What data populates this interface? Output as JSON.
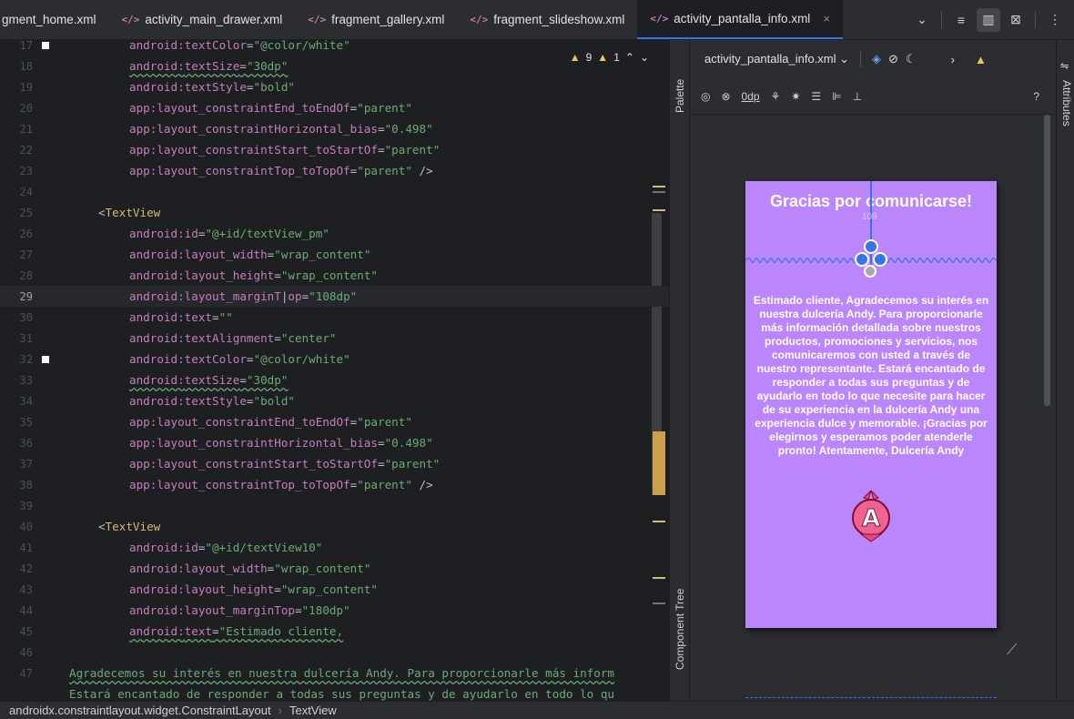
{
  "tabs": [
    {
      "label": "gment_home.xml",
      "active": false,
      "icon": false
    },
    {
      "label": "activity_main_drawer.xml",
      "active": false,
      "icon": true
    },
    {
      "label": "fragment_gallery.xml",
      "active": false,
      "icon": true
    },
    {
      "label": "fragment_slideshow.xml",
      "active": false,
      "icon": true
    },
    {
      "label": "activity_pantalla_info.xml",
      "active": true,
      "icon": true
    }
  ],
  "tab_icon_text": "</>",
  "tab_close": "×",
  "tab_tools": {
    "chevron": "⌄",
    "code_view": "≡",
    "split_view": "▥",
    "design_view": "⊠",
    "more": "⋮"
  },
  "warnings": {
    "warn_count": "9",
    "weak_count": "1",
    "warn_icon": "▲"
  },
  "lines": [
    {
      "n": "17",
      "mark": true,
      "indent": 2,
      "parts": [
        [
          "ns",
          "android:"
        ],
        [
          "attr",
          "textColor"
        ],
        [
          "punct",
          "="
        ],
        [
          "val",
          "\"@color/white\""
        ]
      ]
    },
    {
      "n": "18",
      "mark": false,
      "indent": 2,
      "wavy": true,
      "parts": [
        [
          "ns",
          "android:"
        ],
        [
          "attr",
          "textSize"
        ],
        [
          "punct",
          "="
        ],
        [
          "val",
          "\"30dp\""
        ]
      ]
    },
    {
      "n": "19",
      "mark": false,
      "indent": 2,
      "parts": [
        [
          "ns",
          "android:"
        ],
        [
          "attr",
          "textStyle"
        ],
        [
          "punct",
          "="
        ],
        [
          "val",
          "\"bold\""
        ]
      ]
    },
    {
      "n": "20",
      "mark": false,
      "indent": 2,
      "parts": [
        [
          "ns",
          "app:"
        ],
        [
          "attr",
          "layout_constraintEnd_toEndOf"
        ],
        [
          "punct",
          "="
        ],
        [
          "val",
          "\"parent\""
        ]
      ]
    },
    {
      "n": "21",
      "mark": false,
      "indent": 2,
      "parts": [
        [
          "ns",
          "app:"
        ],
        [
          "attr",
          "layout_constraintHorizontal_bias"
        ],
        [
          "punct",
          "="
        ],
        [
          "val",
          "\"0.498\""
        ]
      ]
    },
    {
      "n": "22",
      "mark": false,
      "indent": 2,
      "parts": [
        [
          "ns",
          "app:"
        ],
        [
          "attr",
          "layout_constraintStart_toStartOf"
        ],
        [
          "punct",
          "="
        ],
        [
          "val",
          "\"parent\""
        ]
      ]
    },
    {
      "n": "23",
      "mark": false,
      "indent": 2,
      "parts": [
        [
          "ns",
          "app:"
        ],
        [
          "attr",
          "layout_constraintTop_toTopOf"
        ],
        [
          "punct",
          "="
        ],
        [
          "val",
          "\"parent\""
        ],
        [
          "punct",
          " />"
        ]
      ]
    },
    {
      "n": "24",
      "mark": false,
      "indent": 0,
      "parts": []
    },
    {
      "n": "25",
      "mark": false,
      "indent": 1,
      "parts": [
        [
          "punct",
          "<"
        ],
        [
          "tag",
          "TextView"
        ]
      ]
    },
    {
      "n": "26",
      "mark": false,
      "indent": 2,
      "parts": [
        [
          "ns",
          "android:"
        ],
        [
          "attr",
          "id"
        ],
        [
          "punct",
          "="
        ],
        [
          "val",
          "\"@+id/textView_pm\""
        ]
      ]
    },
    {
      "n": "27",
      "mark": false,
      "indent": 2,
      "parts": [
        [
          "ns",
          "android:"
        ],
        [
          "attr",
          "layout_width"
        ],
        [
          "punct",
          "="
        ],
        [
          "val",
          "\"wrap_content\""
        ]
      ]
    },
    {
      "n": "28",
      "mark": false,
      "indent": 2,
      "parts": [
        [
          "ns",
          "android:"
        ],
        [
          "attr",
          "layout_height"
        ],
        [
          "punct",
          "="
        ],
        [
          "val",
          "\"wrap_content\""
        ]
      ]
    },
    {
      "n": "29",
      "mark": false,
      "indent": 2,
      "current": true,
      "parts": [
        [
          "ns",
          "android:"
        ],
        [
          "attr",
          "layout_marginT"
        ],
        [
          "punct",
          "|"
        ],
        [
          "attr",
          "op"
        ],
        [
          "punct",
          "="
        ],
        [
          "val",
          "\"108dp\""
        ]
      ]
    },
    {
      "n": "30",
      "mark": false,
      "indent": 2,
      "parts": [
        [
          "ns",
          "android:"
        ],
        [
          "attr",
          "text"
        ],
        [
          "punct",
          "="
        ],
        [
          "val",
          "\"\""
        ]
      ]
    },
    {
      "n": "31",
      "mark": false,
      "indent": 2,
      "parts": [
        [
          "ns",
          "android:"
        ],
        [
          "attr",
          "textAlignment"
        ],
        [
          "punct",
          "="
        ],
        [
          "val",
          "\"center\""
        ]
      ]
    },
    {
      "n": "32",
      "mark": true,
      "indent": 2,
      "parts": [
        [
          "ns",
          "android:"
        ],
        [
          "attr",
          "textColor"
        ],
        [
          "punct",
          "="
        ],
        [
          "val",
          "\"@color/white\""
        ]
      ]
    },
    {
      "n": "33",
      "mark": false,
      "indent": 2,
      "wavy": true,
      "parts": [
        [
          "ns",
          "android:"
        ],
        [
          "attr",
          "textSize"
        ],
        [
          "punct",
          "="
        ],
        [
          "val",
          "\"30dp\""
        ]
      ]
    },
    {
      "n": "34",
      "mark": false,
      "indent": 2,
      "parts": [
        [
          "ns",
          "android:"
        ],
        [
          "attr",
          "textStyle"
        ],
        [
          "punct",
          "="
        ],
        [
          "val",
          "\"bold\""
        ]
      ]
    },
    {
      "n": "35",
      "mark": false,
      "indent": 2,
      "parts": [
        [
          "ns",
          "app:"
        ],
        [
          "attr",
          "layout_constraintEnd_toEndOf"
        ],
        [
          "punct",
          "="
        ],
        [
          "val",
          "\"parent\""
        ]
      ]
    },
    {
      "n": "36",
      "mark": false,
      "indent": 2,
      "parts": [
        [
          "ns",
          "app:"
        ],
        [
          "attr",
          "layout_constraintHorizontal_bias"
        ],
        [
          "punct",
          "="
        ],
        [
          "val",
          "\"0.498\""
        ]
      ]
    },
    {
      "n": "37",
      "mark": false,
      "indent": 2,
      "parts": [
        [
          "ns",
          "app:"
        ],
        [
          "attr",
          "layout_constraintStart_toStartOf"
        ],
        [
          "punct",
          "="
        ],
        [
          "val",
          "\"parent\""
        ]
      ]
    },
    {
      "n": "38",
      "mark": false,
      "indent": 2,
      "parts": [
        [
          "ns",
          "app:"
        ],
        [
          "attr",
          "layout_constraintTop_toTopOf"
        ],
        [
          "punct",
          "="
        ],
        [
          "val",
          "\"parent\""
        ],
        [
          "punct",
          " />"
        ]
      ]
    },
    {
      "n": "39",
      "mark": false,
      "indent": 0,
      "parts": []
    },
    {
      "n": "40",
      "mark": false,
      "indent": 1,
      "parts": [
        [
          "punct",
          "<"
        ],
        [
          "tag",
          "TextView"
        ]
      ]
    },
    {
      "n": "41",
      "mark": false,
      "indent": 2,
      "parts": [
        [
          "ns",
          "android:"
        ],
        [
          "attr",
          "id"
        ],
        [
          "punct",
          "="
        ],
        [
          "val",
          "\"@+id/textView10\""
        ]
      ]
    },
    {
      "n": "42",
      "mark": false,
      "indent": 2,
      "parts": [
        [
          "ns",
          "android:"
        ],
        [
          "attr",
          "layout_width"
        ],
        [
          "punct",
          "="
        ],
        [
          "val",
          "\"wrap_content\""
        ]
      ]
    },
    {
      "n": "43",
      "mark": false,
      "indent": 2,
      "parts": [
        [
          "ns",
          "android:"
        ],
        [
          "attr",
          "layout_height"
        ],
        [
          "punct",
          "="
        ],
        [
          "val",
          "\"wrap_content\""
        ]
      ]
    },
    {
      "n": "44",
      "mark": false,
      "indent": 2,
      "parts": [
        [
          "ns",
          "android:"
        ],
        [
          "attr",
          "layout_marginTop"
        ],
        [
          "punct",
          "="
        ],
        [
          "val",
          "\"180dp\""
        ]
      ]
    },
    {
      "n": "45",
      "mark": false,
      "indent": 2,
      "wavy": true,
      "parts": [
        [
          "ns",
          "android:"
        ],
        [
          "attr",
          "text"
        ],
        [
          "punct",
          "="
        ],
        [
          "val",
          "\"Estimado cliente,"
        ]
      ]
    },
    {
      "n": "46",
      "mark": false,
      "indent": 0,
      "parts": []
    },
    {
      "n": "47",
      "mark": false,
      "indent": 0,
      "wavy": true,
      "parts": [
        [
          "val",
          "Agradecemos su interés en nuestra dulcería Andy. Para proporcionarle más inform"
        ]
      ]
    },
    {
      "n": "",
      "mark": false,
      "indent": 0,
      "wavy": true,
      "parts": [
        [
          "val",
          "Estará encantado de responder a todas sus preguntas y de ayudarlo en todo lo qu"
        ]
      ]
    }
  ],
  "side_labels": {
    "palette": "Palette",
    "component_tree": "Component Tree",
    "attributes": "Attributes"
  },
  "design": {
    "file_dropdown": "activity_pantalla_info.xml ⌄",
    "margin_value": "0dp",
    "help": "?",
    "next": "›",
    "phone_title": "Gracias por comunicarse!",
    "margin_label": "108",
    "phone_body": "Estimado cliente,  Agradecemos su interés en nuestra dulcería Andy. Para proporcionarle más información detallada sobre nuestros productos, promociones y servicios, nos comunicaremos con usted a través de nuestro representante. Estará encantado de responder a todas sus preguntas y de ayudarlo en todo lo que necesite para hacer de su experiencia en la dulcería Andy una experiencia dulce y memorable.  ¡Gracias por elegirnos y esperamos poder atenderle pronto! Atentamente, Dulcería Andy",
    "logo_letter": "A",
    "phone_bg": "#bb86fc"
  },
  "status": {
    "path1": "androidx.constraintlayout.widget.ConstraintLayout",
    "sep": "›",
    "path2": "TextView"
  }
}
